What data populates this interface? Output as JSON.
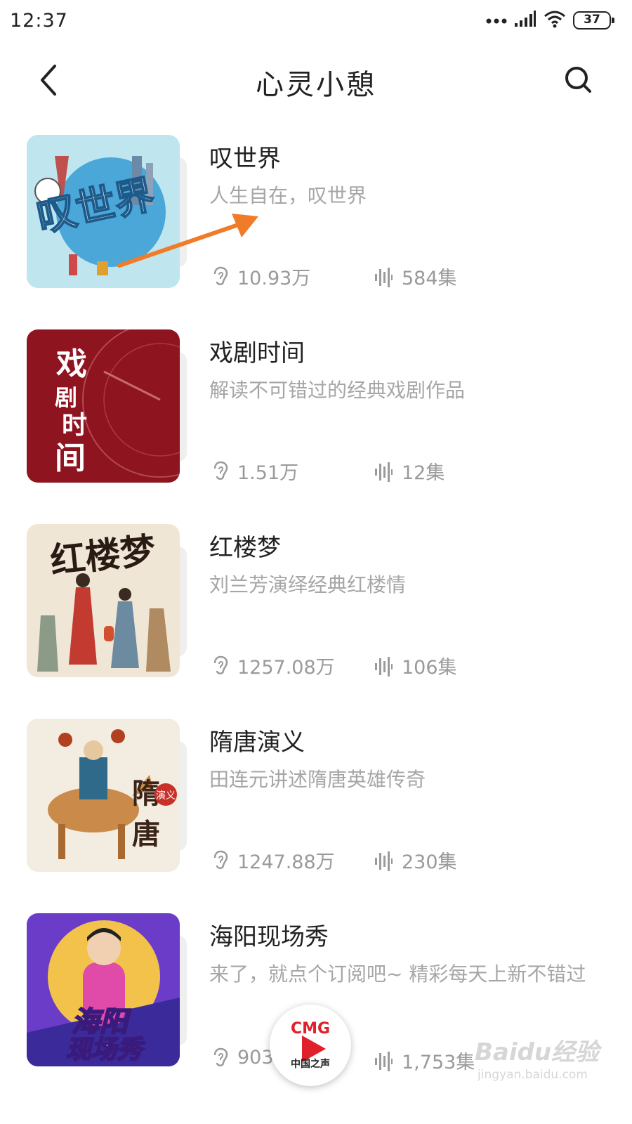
{
  "status_bar": {
    "time": "12:37",
    "battery_level": "37",
    "icons": [
      "more-dots-icon",
      "signal-icon",
      "wifi-icon",
      "battery-icon"
    ]
  },
  "header": {
    "title": "心灵小憩",
    "back_icon": "chevron-left-icon",
    "search_icon": "search-icon"
  },
  "items": [
    {
      "title": "叹世界",
      "description": "人生自在，叹世界",
      "plays": "10.93万",
      "episodes": "584集",
      "cover_text": "叹世界"
    },
    {
      "title": "戏剧时间",
      "description": "解读不可错过的经典戏剧作品",
      "plays": "1.51万",
      "episodes": "12集",
      "cover_text": "戏剧时间"
    },
    {
      "title": "红楼梦",
      "description": "刘兰芳演绎经典红楼情",
      "plays": "1257.08万",
      "episodes": "106集",
      "cover_text": "红楼梦"
    },
    {
      "title": "隋唐演义",
      "description": "田连元讲述隋唐英雄传奇",
      "plays": "1247.88万",
      "episodes": "230集",
      "cover_text": "隋唐演义"
    },
    {
      "title": "海阳现场秀",
      "description": "来了，就点个订阅吧~ 精彩每天上新不错过",
      "plays": "903",
      "episodes": "1,753集",
      "cover_text": "海阳现场秀"
    }
  ],
  "player": {
    "logo": "CMG",
    "subtitle": "中国之声"
  },
  "watermark": {
    "logo": "Baidu经验",
    "url": "jingyan.baidu.com"
  },
  "colors": {
    "annotation_arrow": "#f07c2a",
    "secondary_text": "#a6a6a6",
    "player_red": "#e0202a"
  }
}
